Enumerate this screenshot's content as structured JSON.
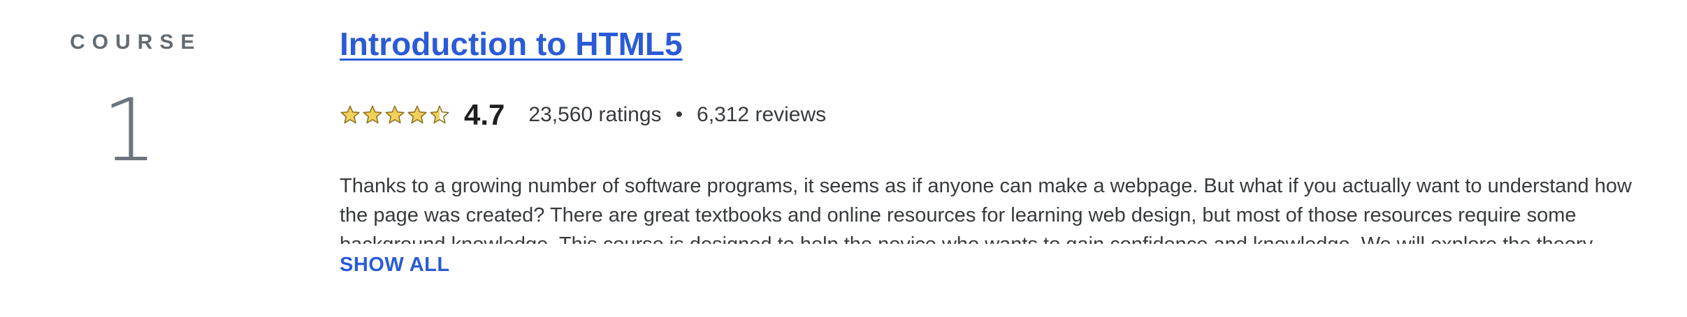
{
  "course": {
    "label": "COURSE",
    "number": "1",
    "title": "Introduction to HTML5",
    "rating": {
      "stars": 4.5,
      "average": "4.7",
      "ratings_text": "23,560 ratings",
      "separator": "•",
      "reviews_text": "6,312 reviews"
    },
    "description": "Thanks to a growing number of software programs, it seems as if anyone can make a webpage. But what if you actually want to understand how the page was created? There are great textbooks and online resources for learning web design, but most of those resources require some background knowledge. This course is designed to help the novice who wants to gain confidence and knowledge. We will explore the theory",
    "show_all_label": "SHOW ALL"
  },
  "colors": {
    "link": "#2a5bd7",
    "star_fill": "#f2d05b",
    "star_stroke": "#8a6d1c"
  }
}
